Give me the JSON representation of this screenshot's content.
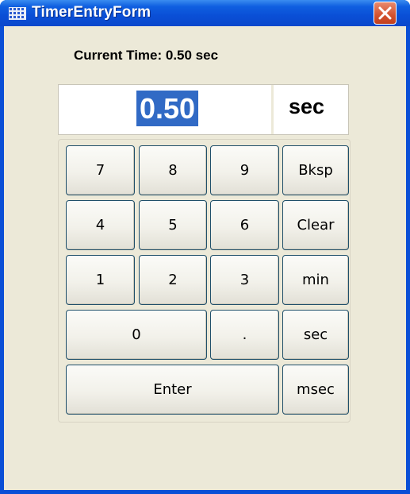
{
  "window": {
    "title": "TimerEntryForm",
    "app_icon": "grid-icon",
    "close_icon": "close-icon"
  },
  "current_time_label": "Current Time: 0.50 sec",
  "display": {
    "value": "0.50",
    "unit": "sec"
  },
  "keys": {
    "k7": "7",
    "k8": "8",
    "k9": "9",
    "bksp": "Bksp",
    "k4": "4",
    "k5": "5",
    "k6": "6",
    "clear": "Clear",
    "k1": "1",
    "k2": "2",
    "k3": "3",
    "min": "min",
    "k0": "0",
    "dot": ".",
    "sec": "sec",
    "enter": "Enter",
    "msec": "msec"
  },
  "colors": {
    "titlebar": "#0a4fd6",
    "selection": "#316ac5",
    "close": "#d4522f",
    "client": "#ece9d8"
  }
}
